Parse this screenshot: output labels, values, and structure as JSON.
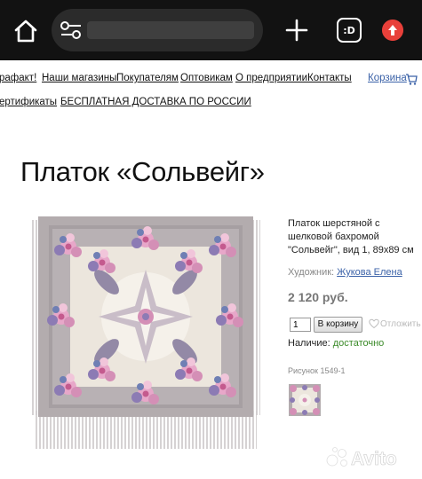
{
  "browser": {
    "url": "",
    "tabs_label": ":D",
    "icons": [
      "home-icon",
      "tune-icon",
      "plus-icon",
      "tabs-icon",
      "update-icon"
    ]
  },
  "nav": {
    "row1": [
      {
        "label": "рафакт!"
      },
      {
        "label": "Наши магазины"
      },
      {
        "label": "Покупателям"
      },
      {
        "label": "Оптовикам"
      },
      {
        "label": "О предприятии"
      },
      {
        "label": "Контакты"
      }
    ],
    "cart_label": "Корзина",
    "row2": [
      {
        "label": "ертификаты"
      },
      {
        "label": "БЕСПЛАТНАЯ ДОСТАВКА ПО РОССИИ"
      }
    ]
  },
  "product": {
    "title": "Платок «Сольвейг»",
    "description": "Платок шерстяной с шелковой бахромой \"Сольвейг\", вид 1, 89x89 см",
    "artist_label": "Художник:",
    "artist_name": "Жукова Елена",
    "price": "2 120 руб.",
    "quantity": "1",
    "add_to_cart_label": "В корзину",
    "wishlist_label": "Отложить",
    "stock_label": "Наличие:",
    "stock_value": "достаточно",
    "drawing_label": "Рисунок 1549-1"
  },
  "watermark": "Avito",
  "colors": {
    "browser_bar": "#121212",
    "link": "#3b62a8",
    "stock_green": "#3a8a28",
    "update_red": "#e8403a",
    "shawl_grey": "#b3acae",
    "shawl_pink": "#d48fb6"
  }
}
